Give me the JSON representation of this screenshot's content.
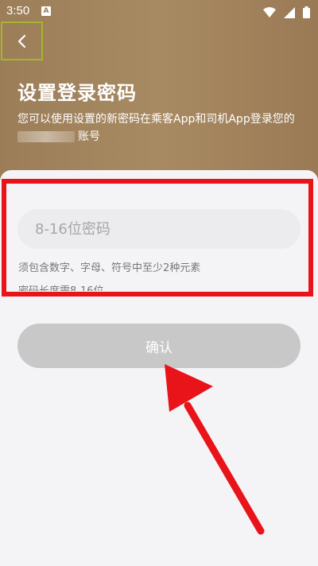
{
  "status_bar": {
    "time": "3:50",
    "notification_letter": "A",
    "icons": [
      "wifi-icon",
      "signal-icon",
      "battery-icon"
    ]
  },
  "header": {
    "back_icon": "chevron-left-icon",
    "title": "设置登录密码",
    "subtitle_line1": "您可以使用设置的新密码在乘客App和司机App登录您的",
    "subtitle_line2_suffix": "账号"
  },
  "form": {
    "password_placeholder": "8-16位密码",
    "password_value": "",
    "hint_rule_chars": "须包含数字、字母、符号中至少2种元素",
    "hint_rule_length": "密码长度需8-16位"
  },
  "actions": {
    "confirm_label": "确认"
  },
  "colors": {
    "header_brown": "#a0825c",
    "highlight_red": "#e8141a",
    "button_disabled": "#c8c8c8"
  }
}
